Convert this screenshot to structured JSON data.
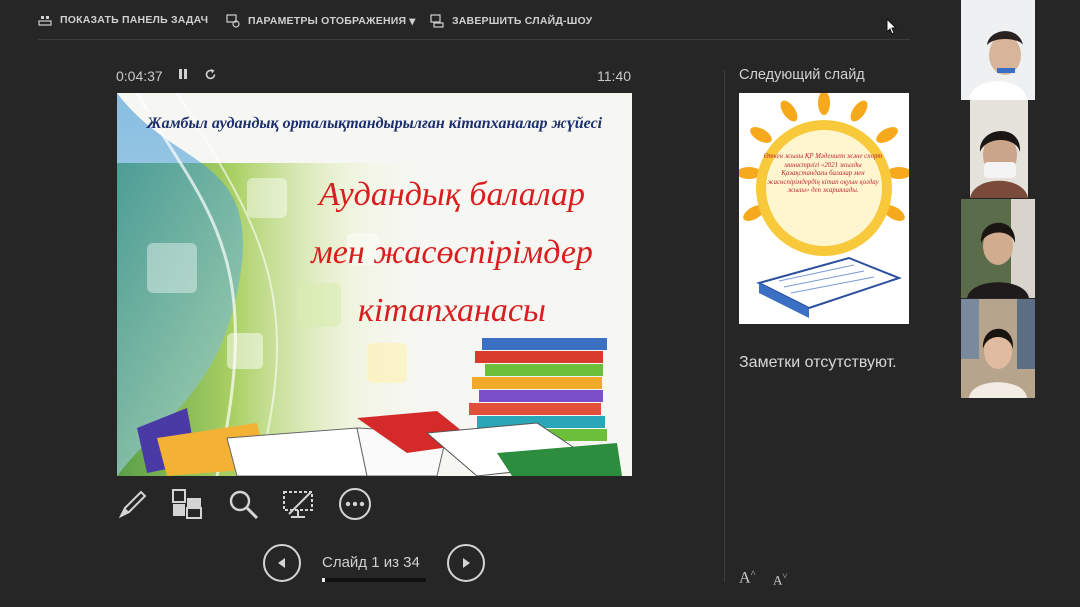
{
  "toolbar": {
    "show_taskbar": "ПОКАЗАТЬ ПАНЕЛЬ ЗАДАЧ",
    "display_settings": "ПАРАМЕТРЫ ОТОБРАЖЕНИЯ",
    "display_settings_arrow": "▾",
    "end_show": "ЗАВЕРШИТЬ СЛАЙД-ШОУ"
  },
  "timer": {
    "elapsed": "0:04:37",
    "pause_icon": "pause-icon",
    "restart_icon": "restart-icon",
    "clock": "11:40"
  },
  "slide": {
    "header": "Жамбыл аудандық орталықтандырылған кітапханалар жүйесі",
    "title_lines": [
      "Аудандық балалар",
      "мен жасөспірімдер",
      "кітапханасы"
    ]
  },
  "tools": [
    "pen-icon",
    "slides-grid-icon",
    "zoom-icon",
    "black-screen-icon",
    "more-options-icon"
  ],
  "navigation": {
    "counter": "Слайд 1 из 34",
    "current": 1,
    "total": 34
  },
  "next_slide": {
    "label": "Следующий слайд",
    "text": "Өткен жылы ҚР Мәдениет және спорт министрлігі «2021 жылды Қазақстандағы балалар мен жасөспірімдердің кітап оқуын қолдау жылы» деп жариялады."
  },
  "notes": {
    "text": "Заметки отсутствуют."
  },
  "font_controls": {
    "increase": "A",
    "decrease": "A"
  },
  "colors": {
    "background": "#262626",
    "slide_title": "#d81e1e",
    "slide_header": "#1e2f6e"
  }
}
